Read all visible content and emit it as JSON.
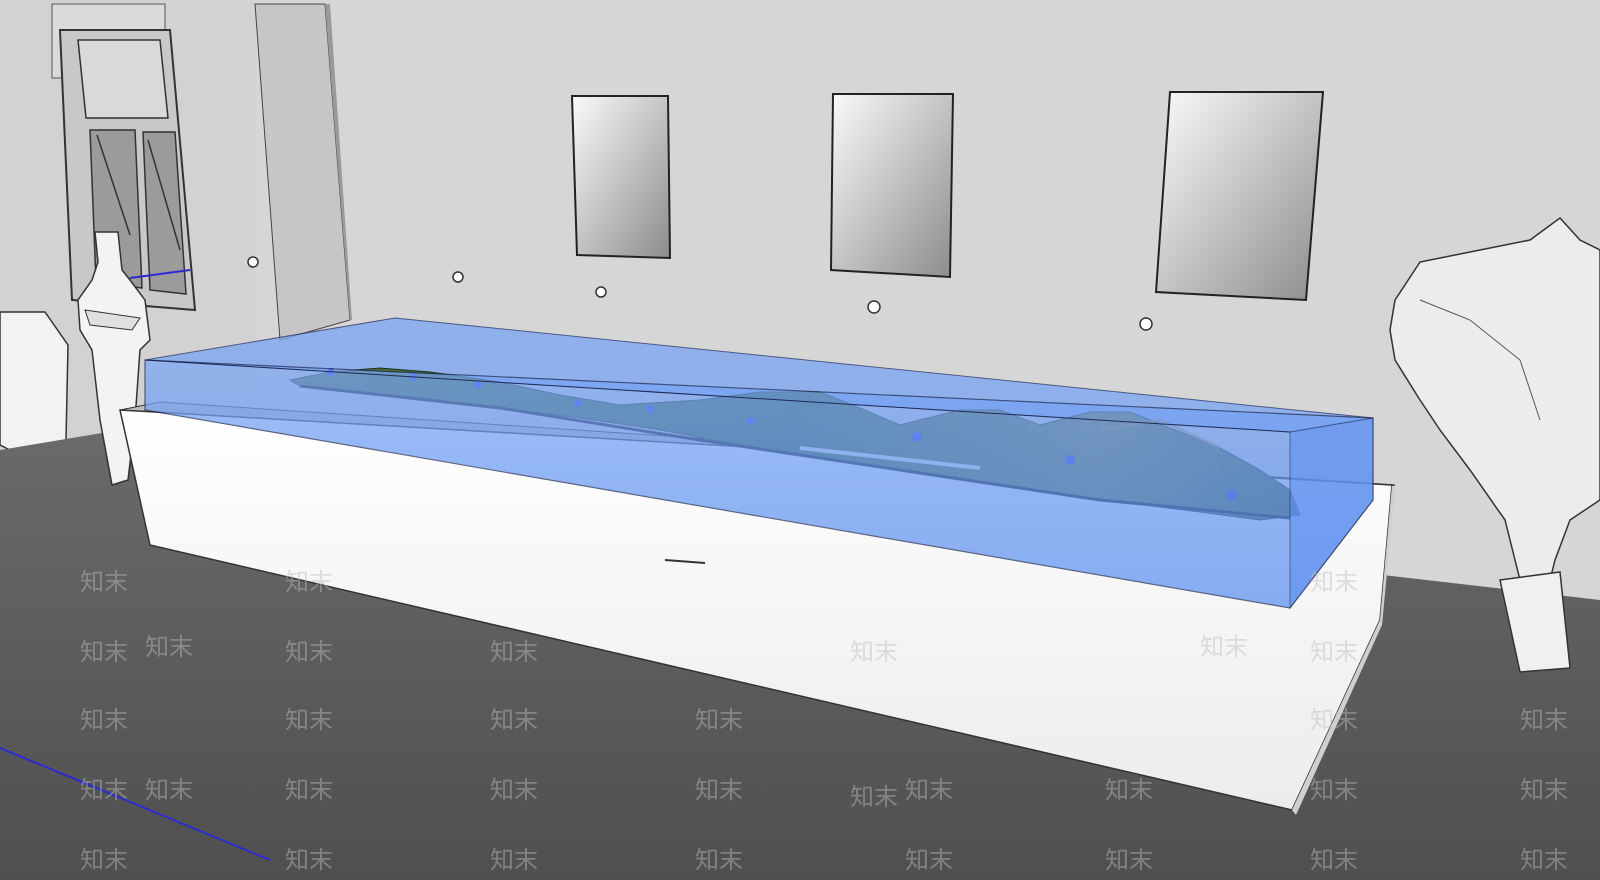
{
  "scene": {
    "wall_color": "#d6d6d6",
    "floor_color": "#5d5d5d",
    "glass_color": "#5b8ff0",
    "terrain_color": "#3f6a3a",
    "marker_color": "#2f3bd6"
  },
  "watermark": {
    "text": "知末",
    "color": "#bdbdbd"
  }
}
